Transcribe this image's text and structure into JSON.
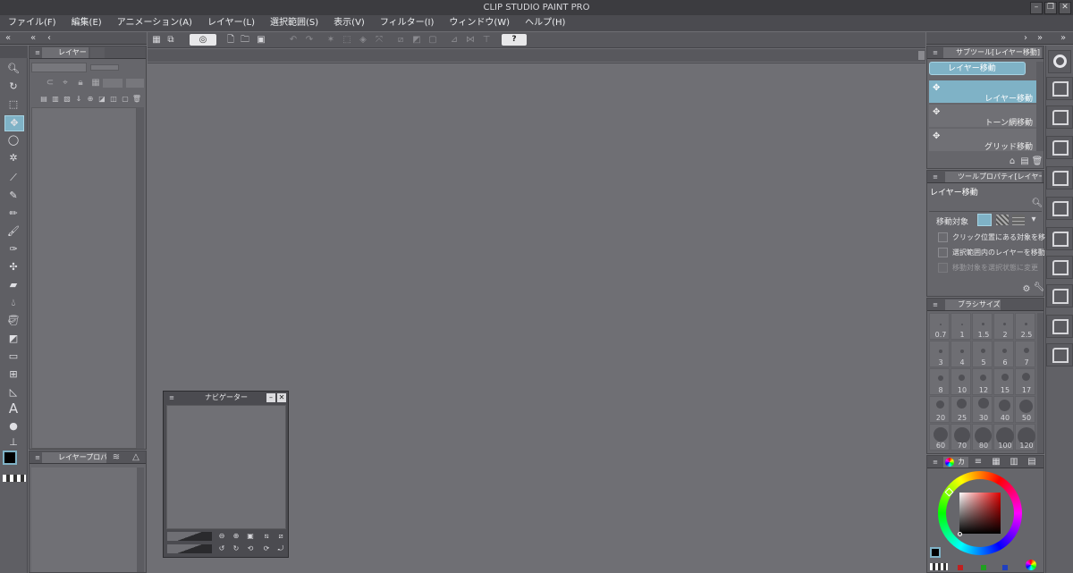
{
  "app": {
    "title": "CLIP STUDIO PAINT PRO"
  },
  "menu": [
    {
      "label": "ファイル(F)"
    },
    {
      "label": "編集(E)"
    },
    {
      "label": "アニメーション(A)"
    },
    {
      "label": "レイヤー(L)"
    },
    {
      "label": "選択範囲(S)"
    },
    {
      "label": "表示(V)"
    },
    {
      "label": "フィルター(I)"
    },
    {
      "label": "ウィンドウ(W)"
    },
    {
      "label": "ヘルプ(H)"
    }
  ],
  "layer_panel": {
    "tab": "レイヤー"
  },
  "layer_property": {
    "tab": "レイヤープロパ"
  },
  "navigator": {
    "title": "ナビゲーター"
  },
  "subtool": {
    "tab": "サブツール[レイヤー移動]",
    "group_button": "レイヤー移動",
    "items": [
      {
        "label": "レイヤー移動",
        "selected": true
      },
      {
        "label": "トーン網移動",
        "selected": false
      },
      {
        "label": "グリッド移動",
        "selected": false
      }
    ]
  },
  "tool_property": {
    "tab": "ツールプロパティ[レイヤー",
    "tool_name": "レイヤー移動",
    "move_target_label": "移動対象",
    "options": [
      {
        "label": "クリック位置にある対象を移動",
        "enabled": true
      },
      {
        "label": "選択範囲内のレイヤーを移動",
        "enabled": true
      },
      {
        "label": "移動対象を選択状態に変更",
        "enabled": false
      }
    ]
  },
  "brush_size": {
    "tab": "ブラシサイズ",
    "sizes": [
      "0.7",
      "1",
      "1.5",
      "2",
      "2.5",
      "3",
      "4",
      "5",
      "6",
      "7",
      "8",
      "10",
      "12",
      "15",
      "17",
      "20",
      "25",
      "30",
      "40",
      "50",
      "60",
      "70",
      "80",
      "100",
      "120"
    ]
  },
  "color": {
    "tab": "カ",
    "accent": "#7fb2c6",
    "foreground": "#000000"
  }
}
